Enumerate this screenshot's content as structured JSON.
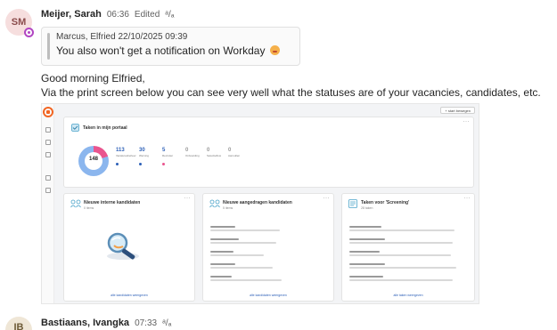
{
  "message1": {
    "avatar_initials": "SM",
    "author": "Meijer, Sarah",
    "time": "06:36",
    "edited": "Edited",
    "translate_glyph": "ᵃ/ₐ",
    "quote": {
      "author_time": "Marcus, Elfried   22/10/2025 09:39",
      "text": "You also won't get a notification on Workday"
    },
    "line1": "Good morning Elfried,",
    "line2": "Via the print screen below you can see very well what the statuses are of your vacancies, candidates, etc."
  },
  "screenshot": {
    "top_button": "+ start bewegen",
    "tasks_card": {
      "title": "Taken in mijn portaal ",
      "donut_total": "148",
      "stats": [
        {
          "num": "113",
          "label": "Vacaturesbeheer",
          "color": "#2c5fb7"
        },
        {
          "num": "30",
          "label": "Werving",
          "color": "#2c5fb7"
        },
        {
          "num": "5",
          "label": "Recruiter",
          "color": "#e9558e"
        },
        {
          "num": "0",
          "label": "Onboarding",
          "color": "#bbbbbb"
        },
        {
          "num": "0",
          "label": "Selectieflow",
          "color": "#bbbbbb"
        },
        {
          "num": "0",
          "label": "Aanvullen",
          "color": "#bbbbbb"
        }
      ]
    },
    "card_internal": {
      "title": "Nieuwe interne kandidaten",
      "sub": "0 items",
      "link": "alle kandidaten weergeven"
    },
    "card_proposed": {
      "title": "Nieuwe aangedragen kandidaten",
      "sub": "5 items",
      "link": "alle kandidaten weergeven"
    },
    "card_tasks": {
      "title": "Taken voor 'Screening'",
      "sub": "28 taken",
      "link": "alle taken weergeven"
    }
  },
  "message2": {
    "avatar_initials": "IB",
    "author": "Bastiaans, Ivangka",
    "time": "07:33",
    "translate_glyph": "ᵃ/ₐ"
  }
}
